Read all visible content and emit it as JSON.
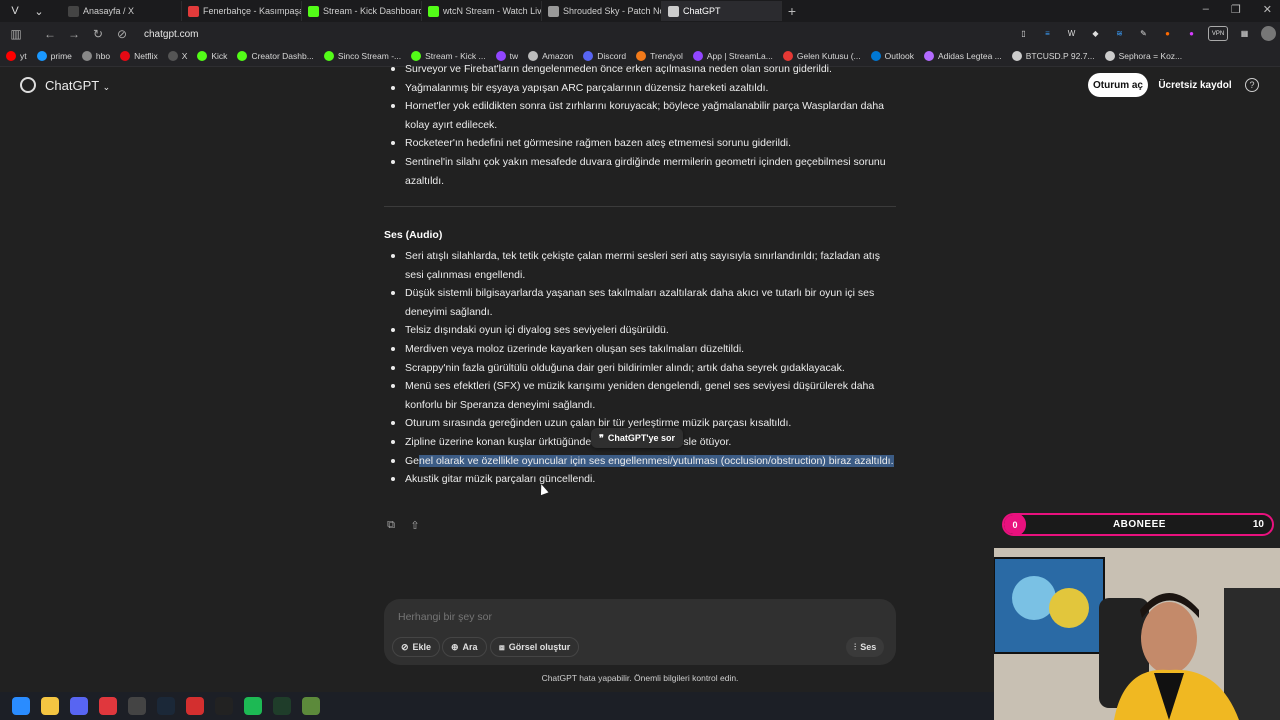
{
  "browser": {
    "tabs": [
      {
        "label": "Anasayfa / X",
        "color": "#444444"
      },
      {
        "label": "Fenerbahçe - Kasımpaşa M",
        "color": "#e23b3b"
      },
      {
        "label": "Stream - Kick Dashboard",
        "color": "#53fc18"
      },
      {
        "label": "wtcN Stream - Watch Live o",
        "color": "#53fc18"
      },
      {
        "label": "Shrouded Sky - Patch Note",
        "color": "#999999"
      },
      {
        "label": "ChatGPT",
        "color": "#cccccc"
      }
    ],
    "url": "chatgpt.com",
    "bookmarks": [
      {
        "label": "yt",
        "color": "#ff0000"
      },
      {
        "label": "prime",
        "color": "#1a98ff"
      },
      {
        "label": "hbo",
        "color": "#888888"
      },
      {
        "label": "Netflix",
        "color": "#e50914"
      },
      {
        "label": "X",
        "color": "#555555"
      },
      {
        "label": "Kick",
        "color": "#53fc18"
      },
      {
        "label": "Creator Dashb...",
        "color": "#53fc18"
      },
      {
        "label": "Sinco Stream -...",
        "color": "#53fc18"
      },
      {
        "label": "Stream - Kick ...",
        "color": "#53fc18"
      },
      {
        "label": "tw",
        "color": "#9146ff"
      },
      {
        "label": "Amazon",
        "color": "#bbbbbb"
      },
      {
        "label": "Discord",
        "color": "#5865f2"
      },
      {
        "label": "Trendyol",
        "color": "#f27a1a"
      },
      {
        "label": "App | StreamLa...",
        "color": "#9146ff"
      },
      {
        "label": "Gelen Kutusu (...",
        "color": "#e53935"
      },
      {
        "label": "Outlook",
        "color": "#0078d4"
      },
      {
        "label": "Adidas Legtea ...",
        "color": "#b36bff"
      },
      {
        "label": "BTCUSD.P 92.7...",
        "color": "#cccccc"
      },
      {
        "label": "Sephora = Koz...",
        "color": "#cccccc"
      }
    ]
  },
  "header": {
    "app_title": "ChatGPT",
    "login_label": "Oturum aç",
    "signup_label": "Ücretsiz kaydol",
    "help_label": "?"
  },
  "content": {
    "top_items": [
      "Surveyor ve Firebat'ların dengelenmeden önce erken açılmasına neden olan sorun giderildi.",
      "Yağmalanmış bir eşyaya yapışan ARC parçalarının düzensiz hareketi azaltıldı.",
      "Hornet'ler yok edildikten sonra üst zırhlarını koruyacak; böylece yağmalanabilir parça Wasplardan daha kolay ayırt edilecek.",
      "Rocketeer'ın hedefini net görmesine rağmen bazen ateş etmemesi sorunu giderildi.",
      "Sentinel'in silahı çok yakın mesafede duvara girdiğinde mermilerin geometri içinden geçebilmesi sorunu azaltıldı."
    ],
    "audio_heading": "Ses (Audio)",
    "audio_items": [
      "Seri atışlı silahlarda, tek tetik çekişte çalan mermi sesleri seri atış sayısıyla sınırlandırıldı; fazladan atış sesi çalınması engellendi.",
      "Düşük sistemli bilgisayarlarda yaşanan ses takılmaları azaltılarak daha akıcı ve tutarlı bir oyun içi ses deneyimi sağlandı.",
      "Telsiz dışındaki oyun içi diyalog ses seviyeleri düşürüldü.",
      "Merdiven veya moloz üzerinde kayarken oluşan ses takılmaları düzeltildi.",
      "Scrappy'nin fazla gürültülü olduğuna dair geri bildirimler alındı; artık daha seyrek gıdaklayacak.",
      "Menü ses efektleri (SFX) ve müzik karışımı yeniden dengelendi, genel ses seviyesi düşürülerek daha konforlu bir Speranza deneyimi sağlandı.",
      "Oturum sırasında gereğinden uzun çalan bir tür yerleştirme müzik parçası kısaltıldı.",
      "Zipline üzerine konan kuşlar ürktüğünde artık daha doğal sesle ötüyor."
    ],
    "highlight_prefix": "Ge",
    "highlight_text": "nel olarak ve özellikle oyuncular için ses engellenmesi/yutulması (occlusion/obstruction) biraz azaltıldı.",
    "last_item": "Akustik gitar müzik parçaları güncellendi."
  },
  "tooltip": {
    "label": "ChatGPT'ye sor"
  },
  "composer": {
    "placeholder": "Herhangi bir şey sor",
    "attach_label": "Ekle",
    "search_label": "Ara",
    "image_label": "Görsel oluştur",
    "voice_label": "Ses"
  },
  "disclaimer": "ChatGPT hata yapabilir. Önemli bilgileri kontrol edin.",
  "overlay": {
    "sub_count": "0",
    "sub_label": "ABONEEE",
    "sub_goal": "10",
    "progress_fraction": 0
  },
  "taskbar": {
    "apps": [
      {
        "name": "windows-start-icon",
        "color": "#2a8cff"
      },
      {
        "name": "file-explorer-icon",
        "color": "#f4c542"
      },
      {
        "name": "discord-icon",
        "color": "#5865f2"
      },
      {
        "name": "vivaldi-icon",
        "color": "#e0373d"
      },
      {
        "name": "obs-icon",
        "color": "#444444"
      },
      {
        "name": "steam-icon",
        "color": "#1b2838"
      },
      {
        "name": "app-red-icon",
        "color": "#d32f2f"
      },
      {
        "name": "capcut-icon",
        "color": "#222222"
      },
      {
        "name": "spotify-icon",
        "color": "#1db954"
      },
      {
        "name": "terminal-icon",
        "color": "#1f3d2a"
      },
      {
        "name": "minecraft-icon",
        "color": "#5c8a3b"
      }
    ]
  }
}
